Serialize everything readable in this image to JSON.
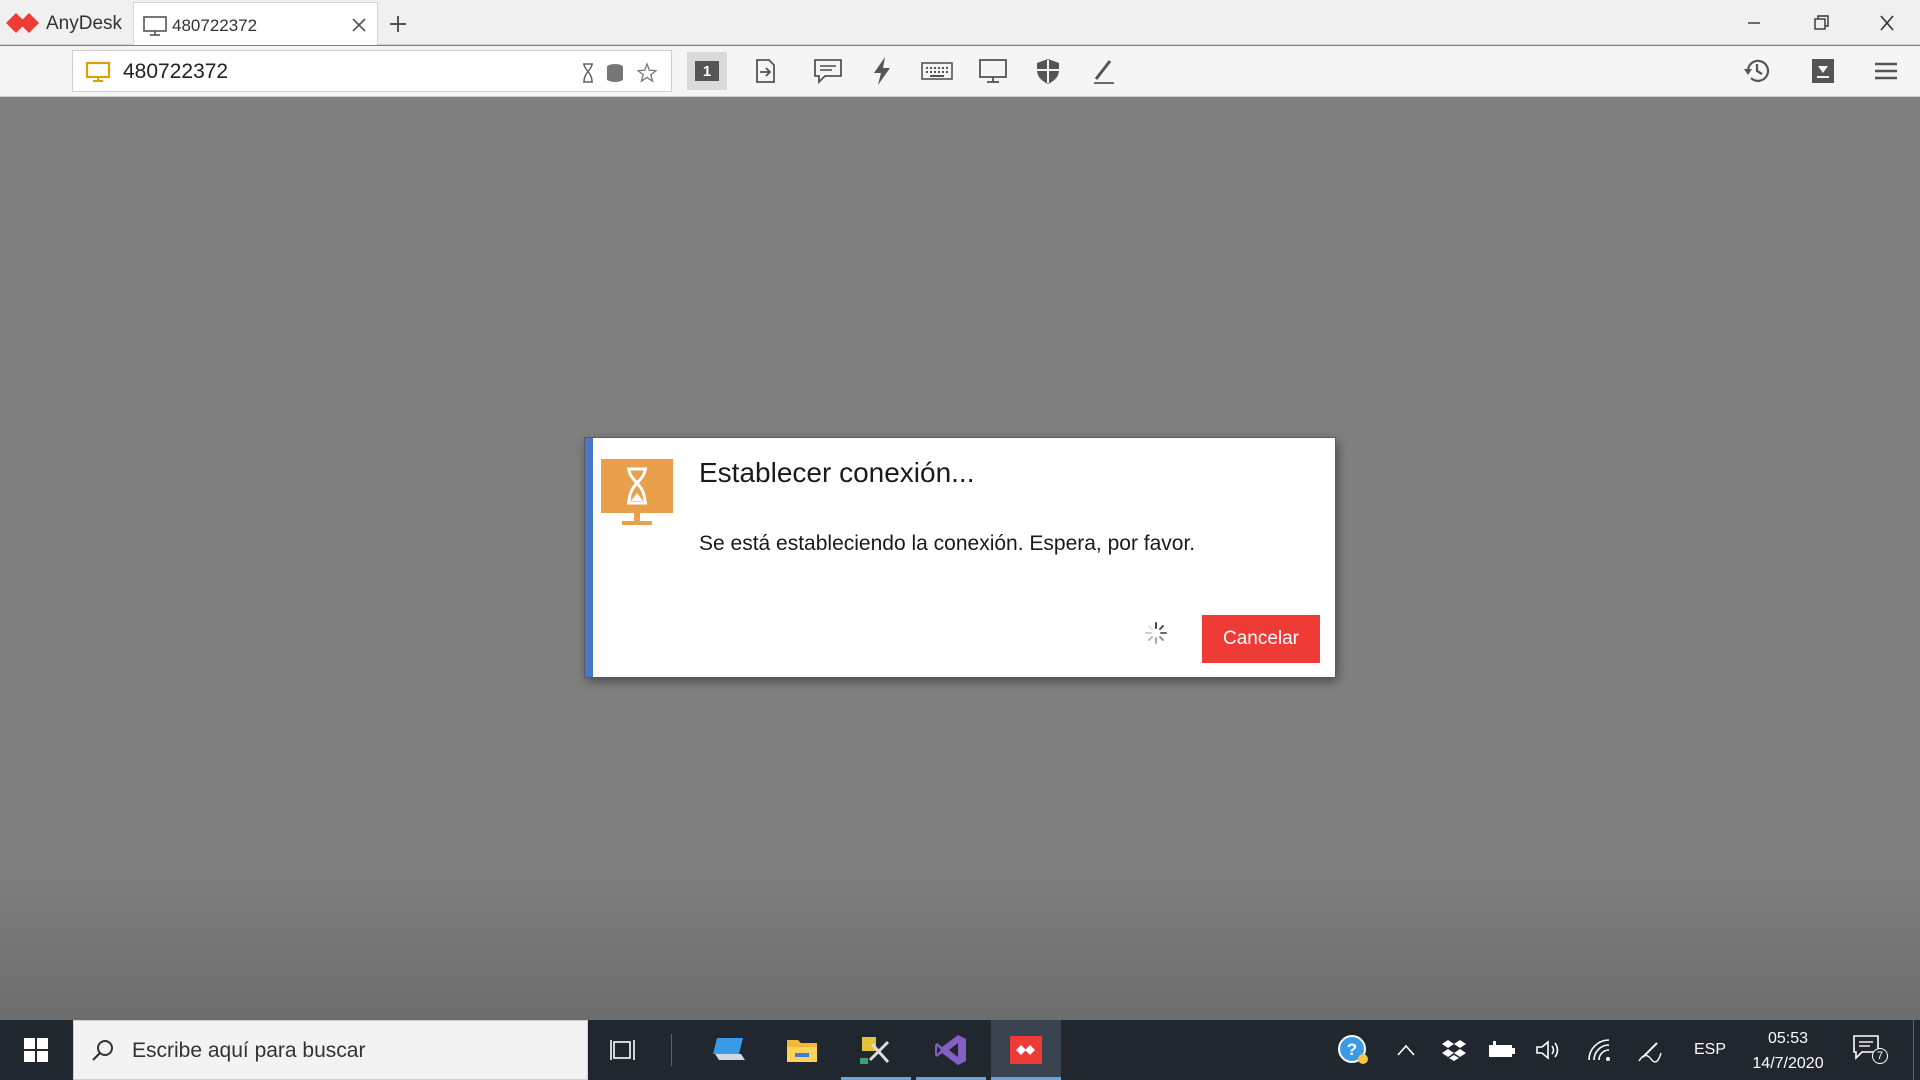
{
  "app": {
    "name": "AnyDesk",
    "brand_color": "#ef3b36"
  },
  "tab": {
    "label": "480722372",
    "icon": "monitor-icon"
  },
  "toolbar": {
    "address_value": "480722372",
    "display_number": "1",
    "buttons": [
      "display-icon",
      "transfer-icon",
      "chat-icon",
      "actions-icon",
      "keyboard-icon",
      "monitor-icon",
      "permissions-icon",
      "whiteboard-icon"
    ],
    "right_buttons": [
      "history-icon",
      "install-icon",
      "menu-icon"
    ]
  },
  "dialog": {
    "title": "Establecer conexión...",
    "message": "Se está estableciendo la conexión. Espera, por favor.",
    "cancel_label": "Cancelar",
    "accent_color": "#4a78c8",
    "icon_color": "#e8a04c"
  },
  "taskbar": {
    "search_placeholder": "Escribe aquí para buscar",
    "apps": [
      "task-view-icon",
      "this-pc-icon",
      "file-explorer-icon",
      "tools-icon",
      "visual-studio-icon",
      "anydesk-icon"
    ],
    "tray": {
      "language": "ESP",
      "time": "05:53",
      "date": "14/7/2020",
      "notifications": "7"
    }
  }
}
